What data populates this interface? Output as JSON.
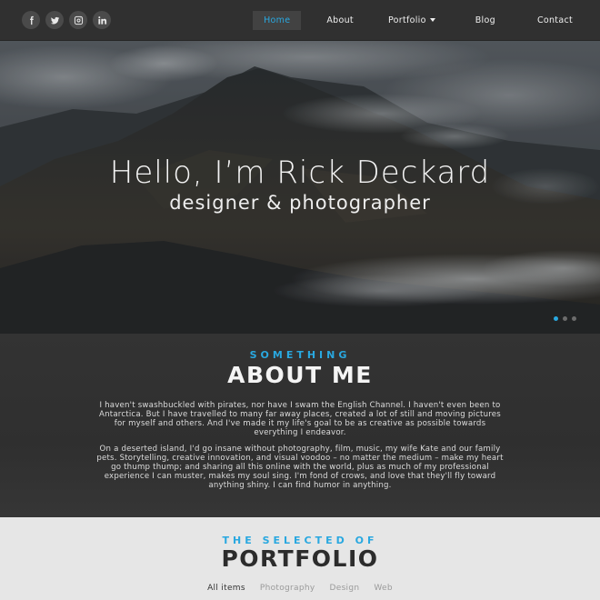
{
  "nav": {
    "social_icons": [
      "facebook-icon",
      "twitter-icon",
      "instagram-icon",
      "linkedin-icon"
    ],
    "menu": [
      {
        "label": "Home",
        "active": true
      },
      {
        "label": "About"
      },
      {
        "label": "Portfolio",
        "has_dropdown": true
      },
      {
        "label": "Blog"
      },
      {
        "label": "Contact"
      }
    ]
  },
  "hero": {
    "title": "Hello, I’m Rick Deckard",
    "subtitle": "designer & photographer",
    "slides": 3,
    "active_slide": 1
  },
  "about": {
    "kicker": "SOMETHING",
    "title": "ABOUT ME",
    "paragraph1_lines": [
      "I haven't swashbuckled with pirates, nor have I swam the English Channel. I haven't even been to",
      "Antarctica. But I have travelled to many far away places, created a lot of still and moving pictures",
      "for myself and others. And I've made it my life's goal to be as creative as possible towards",
      "everything I endeavor."
    ],
    "paragraph2_lines": [
      "On a deserted island, I'd go insane without photography, film, music, my wife Kate and our family",
      "pets. Storytelling, creative innovation, and visual voodoo – no matter the medium – make my heart",
      "go thump thump; and sharing all this online with the world, plus as much of my professional",
      "experience I can muster, makes my soul sing. I'm fond of crows, and love that they'll fly toward",
      "anything shiny. I can find humor in anything."
    ]
  },
  "portfolio": {
    "kicker": "THE SELECTED OF",
    "title": "PORTFOLIO",
    "filters": [
      "All items",
      "Photography",
      "Design",
      "Web"
    ],
    "active_filter": "All items"
  },
  "colors": {
    "accent": "#29a8e0",
    "nav_bg": "#303030",
    "about_bg": "#333333",
    "portfolio_bg": "#e6e6e6"
  }
}
